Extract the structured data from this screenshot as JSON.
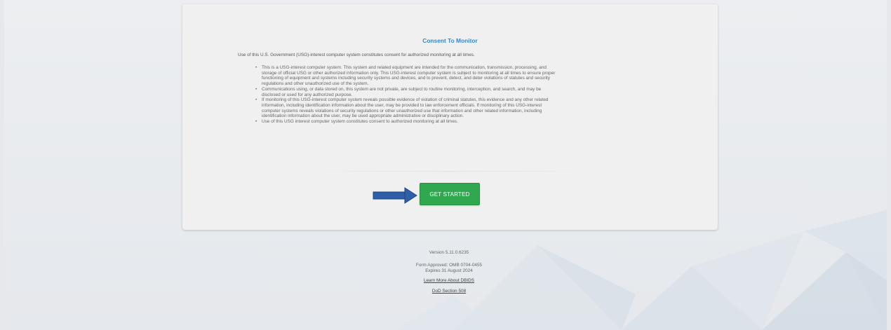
{
  "consent": {
    "title": "Consent To Monitor",
    "intro": "Use of this U.S. Government (USG)-interest computer system constitutes consent for authorized monitoring at all times.",
    "bullets": [
      {
        "lines": [
          "This is a USG-interest computer system. This system and related equipment are intended for the communication, transmission, processing, and",
          "storage of official USG or other authorized information only. This USG-interest computer system is subject to monitoring at all times to ensure proper",
          "functioning of equipment and systems including security systems and devices, and to prevent, detect, and deter violations of statutes and security",
          "regulations and other unauthorized use of the system."
        ]
      },
      {
        "lines": [
          "Communications using, or data stored on, this system are not private, are subject to routine monitoring, interception, and search, and may be",
          "disclosed or used for any authorized purpose."
        ]
      },
      {
        "lines": [
          "If monitoring of this USG-interest computer system reveals possible evidence of violation of criminal statutes, this evidence and any other related",
          "information, including identification information about the user, may be provided to law enforcement officials. If monitoring of this USG-interest",
          "computer systems reveals violations of security regulations or other unauthorized use that information and other related information, including",
          "identification information about the user, may be used appropriate administrative or disciplinary action."
        ]
      },
      {
        "lines": [
          "Use of this USG interest computer system constitutes consent to authorized monitoring at all times."
        ]
      }
    ]
  },
  "start_button": {
    "label": "GET STARTED",
    "color": "#2fa84f"
  },
  "arrow_icon": "arrow-right-icon",
  "footer": {
    "version": "Version 5.11.0.6235",
    "form_approved": "Form Approved: OMB 0704-0455",
    "expires": "Expires 31 August 2024",
    "learn_more_link": "Learn More About DBIDS",
    "section_508_link": "DoD Section 508"
  },
  "colors": {
    "title": "#2e8bc9",
    "arrow": "#2f5fa8",
    "background": "#e6e8ec"
  }
}
